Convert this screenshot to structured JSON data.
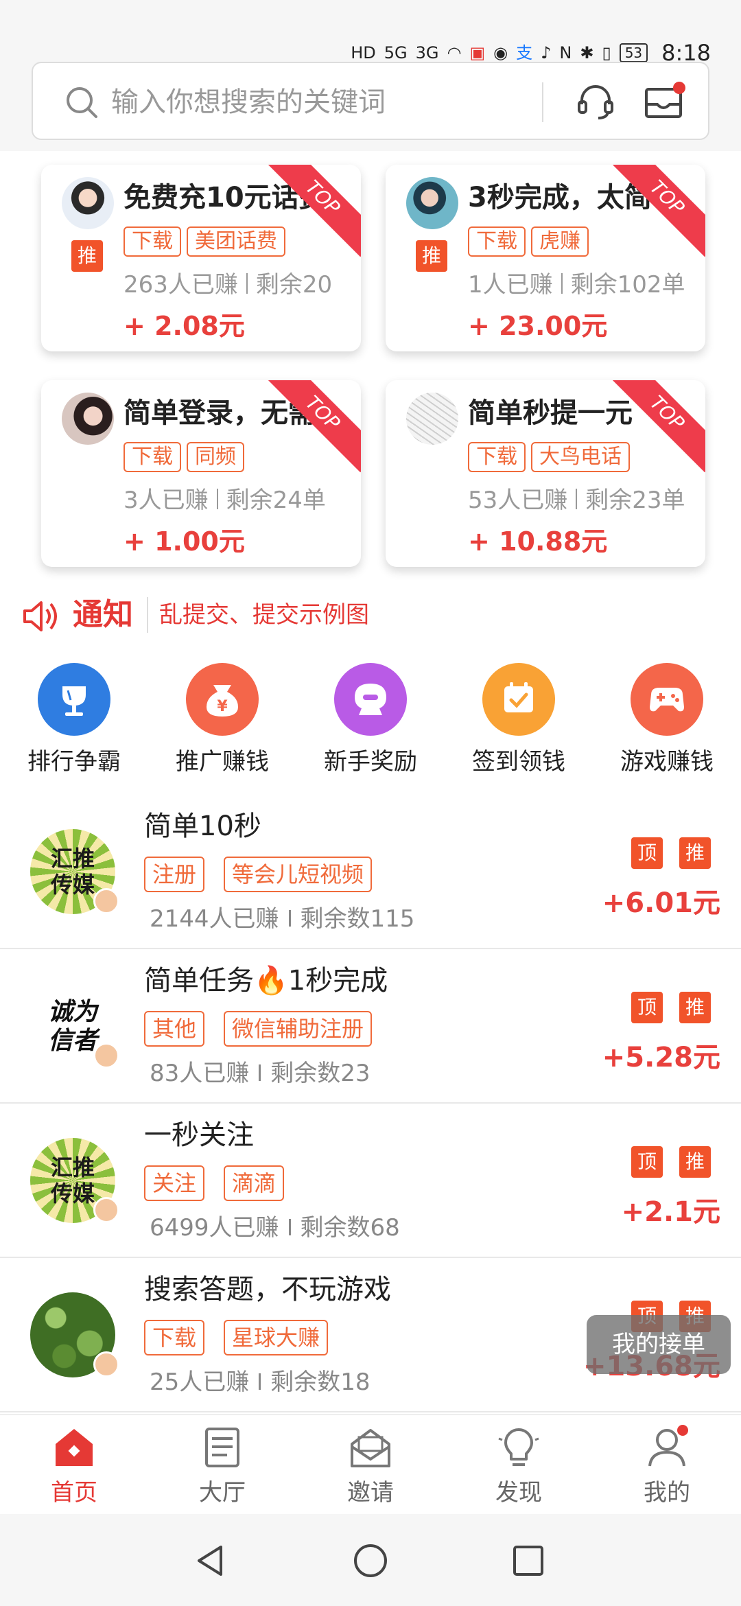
{
  "status_bar": {
    "network_1": "HD",
    "network_2": "5G",
    "network_3": "3G",
    "battery": "53",
    "time": "8:18"
  },
  "search": {
    "placeholder": "输入你想搜索的关键词"
  },
  "cards": [
    {
      "title": "免费充10元话费",
      "tags": [
        "下载",
        "美团话费"
      ],
      "earned": "263人已赚",
      "remaining": "剩余20",
      "reward": "+ 2.08元",
      "ribbon": "TOP",
      "recommend": "推",
      "avatar": "avatar-girl-white"
    },
    {
      "title": "3秒完成，太简单",
      "tags": [
        "下载",
        "虎赚"
      ],
      "earned": "1人已赚",
      "remaining": "剩余102单",
      "reward": "+ 23.00元",
      "ribbon": "TOP",
      "recommend": "推",
      "avatar": "avatar-girl-blue"
    },
    {
      "title": "简单登录，无需",
      "tags": [
        "下载",
        "同频"
      ],
      "earned": "3人已赚",
      "remaining": "剩余24单",
      "reward": "+ 1.00元",
      "ribbon": "TOP",
      "avatar": "avatar-girl-dark"
    },
    {
      "title": "简单秒提一元",
      "tags": [
        "下载",
        "大鸟电话"
      ],
      "earned": "53人已赚",
      "remaining": "剩余23单",
      "reward": "+ 10.88元",
      "ribbon": "TOP",
      "avatar": "avatar-sketch"
    }
  ],
  "notice": {
    "title": "通知",
    "text": "乱提交、提交示例图"
  },
  "quick_menu": [
    {
      "label": "排行争霸",
      "icon": "trophy-icon",
      "color": "#2f7de1"
    },
    {
      "label": "推广赚钱",
      "icon": "money-bag-icon",
      "color": "#f4664a"
    },
    {
      "label": "新手奖励",
      "icon": "gift-icon",
      "color": "#b95be6"
    },
    {
      "label": "签到领钱",
      "icon": "calendar-check-icon",
      "color": "#f9a235"
    },
    {
      "label": "游戏赚钱",
      "icon": "gamepad-icon",
      "color": "#f4664a"
    }
  ],
  "tasks": [
    {
      "title": "简单10秒",
      "tags": [
        "注册",
        "等会儿短视频"
      ],
      "earned": "2144人已赚",
      "remaining": "剩余数115",
      "reward": "+6.01元",
      "badge_top": "顶",
      "badge_rec": "推",
      "avatar": "huitui-logo",
      "avatar_text": [
        "汇推",
        "传媒"
      ]
    },
    {
      "title": "简单任务🔥1秒完成",
      "tags": [
        "其他",
        "微信辅助注册"
      ],
      "earned": "83人已赚",
      "remaining": "剩余数23",
      "reward": "+5.28元",
      "badge_top": "顶",
      "badge_rec": "推",
      "avatar": "calligraphy-logo",
      "avatar_text": [
        "诚为",
        "信者"
      ]
    },
    {
      "title": "一秒关注",
      "tags": [
        "关注",
        "滴滴"
      ],
      "earned": "6499人已赚",
      "remaining": "剩余数68",
      "reward": "+2.1元",
      "badge_top": "顶",
      "badge_rec": "推",
      "avatar": "huitui-logo",
      "avatar_text": [
        "汇推",
        "传媒"
      ]
    },
    {
      "title": "搜索答题，不玩游戏",
      "tags": [
        "下载",
        "星球大赚"
      ],
      "earned": "25人已赚",
      "remaining": "剩余数18",
      "reward": "+13.68元",
      "badge_top": "顶",
      "badge_rec": "推",
      "avatar": "leaves-photo"
    }
  ],
  "float_button": "我的接单",
  "bottom_nav": [
    {
      "label": "首页",
      "icon": "home-icon",
      "active": true
    },
    {
      "label": "大厅",
      "icon": "list-icon",
      "active": false
    },
    {
      "label": "邀请",
      "icon": "envelope-icon",
      "active": false
    },
    {
      "label": "发现",
      "icon": "lightbulb-icon",
      "active": false
    },
    {
      "label": "我的",
      "icon": "profile-icon",
      "active": false
    }
  ],
  "colors": {
    "accent_red": "#e53935",
    "tag_orange": "#f06a3a",
    "badge_orange": "#f1532a"
  }
}
